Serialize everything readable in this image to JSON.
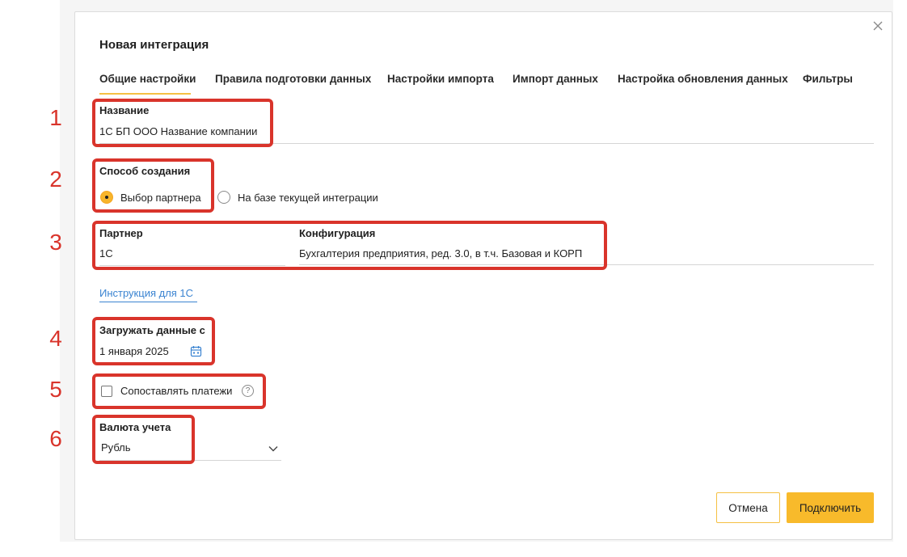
{
  "modal": {
    "title": "Новая интеграция",
    "close_icon": "close-icon"
  },
  "tabs": [
    {
      "label": "Общие настройки",
      "active": true
    },
    {
      "label": "Правила подготовки данных",
      "active": false
    },
    {
      "label": "Настройки импорта",
      "active": false
    },
    {
      "label": "Импорт данных",
      "active": false
    },
    {
      "label": "Настройка обновления данных",
      "active": false
    },
    {
      "label": "Фильтры",
      "active": false
    }
  ],
  "annotations": [
    "1",
    "2",
    "3",
    "4",
    "5",
    "6"
  ],
  "name_field": {
    "label": "Название",
    "value": "1С БП ООО Название компании"
  },
  "creation_method": {
    "label": "Способ создания",
    "options": [
      {
        "label": "Выбор партнера",
        "selected": true
      },
      {
        "label": "На базе текущей интеграции",
        "selected": false
      }
    ]
  },
  "partner": {
    "label": "Партнер",
    "value": "1С"
  },
  "configuration": {
    "label": "Конфигурация",
    "value": "Бухгалтерия предприятия, ред. 3.0, в т.ч. Базовая и КОРП"
  },
  "instruction_link": "Инструкция для 1С",
  "load_from": {
    "label": "Загружать данные с",
    "value": "1 января 2025",
    "icon": "calendar-icon"
  },
  "match_payments": {
    "label": "Сопоставлять платежи",
    "checked": false,
    "help_icon": "help-icon"
  },
  "currency": {
    "label": "Валюта учета",
    "value": "Рубль",
    "icon": "chevron-down-icon"
  },
  "buttons": {
    "cancel": "Отмена",
    "connect": "Подключить"
  },
  "colors": {
    "accent": "#f8ba2b",
    "annotation": "#d9342b",
    "link": "#3b84d1"
  }
}
